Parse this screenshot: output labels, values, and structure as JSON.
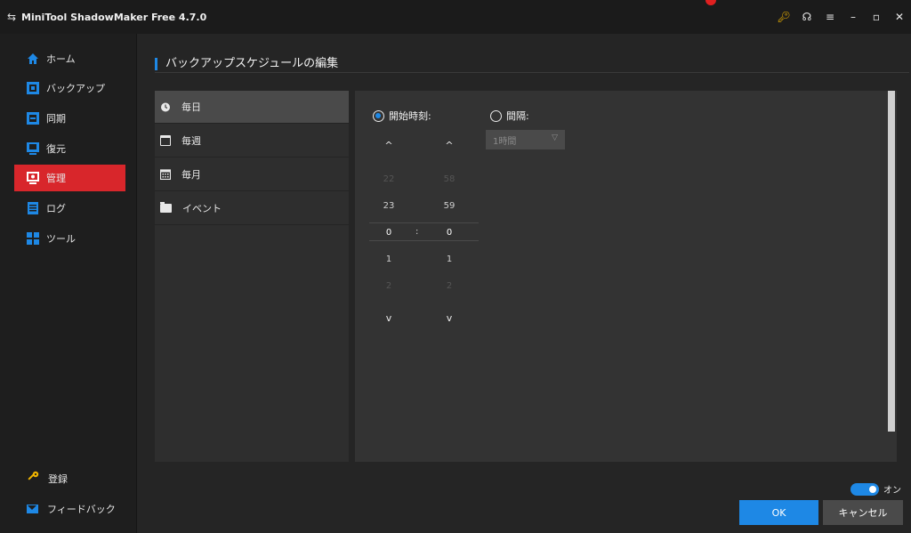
{
  "titlebar": {
    "title": "MiniTool ShadowMaker Free 4.7.0",
    "controls": [
      "key-icon",
      "headset-icon",
      "menu-icon",
      "minimize-icon",
      "maximize-icon",
      "close-icon"
    ]
  },
  "sidebar": {
    "items": [
      {
        "label": "ホーム",
        "icon": "home-icon"
      },
      {
        "label": "バックアップ",
        "icon": "backup-icon"
      },
      {
        "label": "同期",
        "icon": "sync-icon"
      },
      {
        "label": "復元",
        "icon": "restore-icon"
      },
      {
        "label": "管理",
        "icon": "manage-icon",
        "active": true
      },
      {
        "label": "ログ",
        "icon": "log-icon"
      },
      {
        "label": "ツール",
        "icon": "tools-icon"
      }
    ],
    "bottom": [
      {
        "label": "登録",
        "icon": "key-icon"
      },
      {
        "label": "フィードバック",
        "icon": "mail-icon"
      }
    ]
  },
  "main": {
    "title": "バックアップスケジュールの編集",
    "frequency": [
      {
        "label": "毎日",
        "icon": "clock-icon",
        "selected": true
      },
      {
        "label": "毎週",
        "icon": "calendar-week-icon"
      },
      {
        "label": "毎月",
        "icon": "calendar-month-icon"
      },
      {
        "label": "イベント",
        "icon": "folder-icon"
      }
    ],
    "start_time": {
      "label": "開始時刻:",
      "checked": true,
      "hours": [
        "22",
        "23",
        "0",
        "1",
        "2"
      ],
      "minutes": [
        "58",
        "59",
        "0",
        "1",
        "2"
      ],
      "separator": ":",
      "up_arrow": "^",
      "down_arrow": "v"
    },
    "interval": {
      "label": "間隔:",
      "checked": false,
      "value": "1時間"
    }
  },
  "footer": {
    "toggle_label": "オン",
    "toggle_on": true,
    "ok": "OK",
    "cancel": "キャンセル"
  },
  "colors": {
    "accent": "#1e88e5",
    "active_nav": "#d8262b",
    "key": "#f0b400"
  }
}
